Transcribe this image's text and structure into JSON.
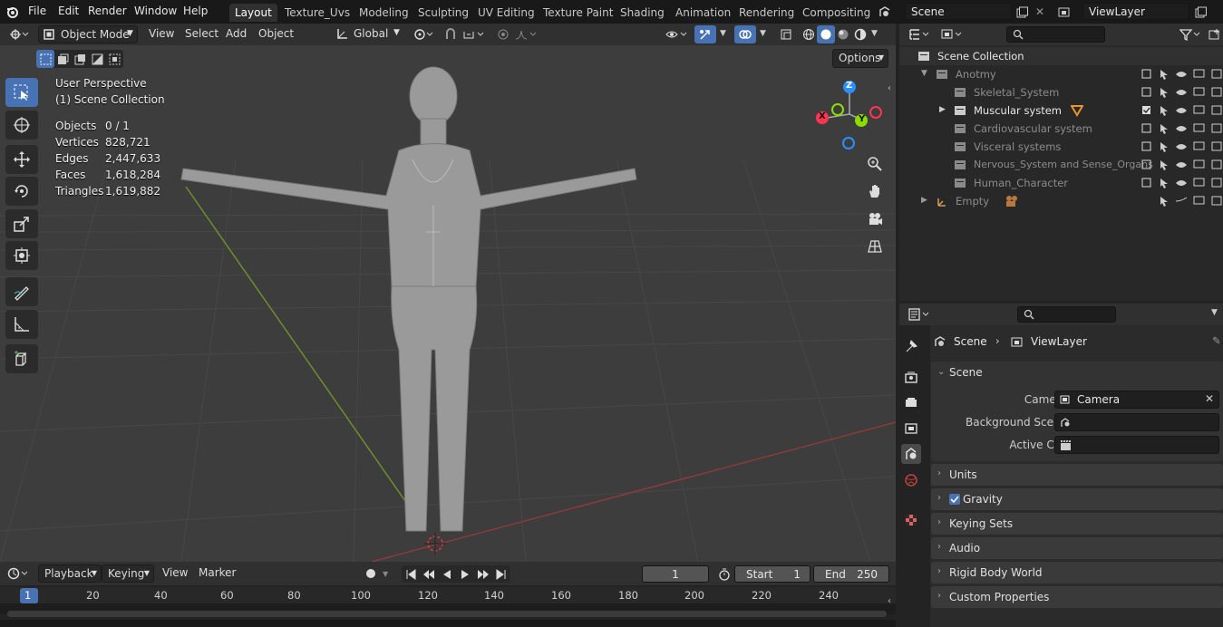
{
  "topbar": {
    "menus": [
      "File",
      "Edit",
      "Render",
      "Window",
      "Help"
    ],
    "workspaces": [
      "Layout",
      "Texture_Uvs",
      "Modeling",
      "Sculpting",
      "UV Editing",
      "Texture Paint",
      "Shading",
      "Animation",
      "Rendering",
      "Compositing"
    ],
    "active_workspace": "Layout",
    "scene_name": "Scene",
    "view_layer_name": "ViewLayer"
  },
  "viewport_header": {
    "mode": "Object Mode",
    "menus": [
      "View",
      "Select",
      "Add",
      "Object"
    ],
    "orientation": "Global",
    "options_label": "Options"
  },
  "overlay": {
    "view_name": "User Perspective",
    "collection": "(1) Scene Collection",
    "stats": [
      {
        "label": "Objects",
        "value": "0 / 1"
      },
      {
        "label": "Vertices",
        "value": "828,721"
      },
      {
        "label": "Edges",
        "value": "2,447,633"
      },
      {
        "label": "Faces",
        "value": "1,618,284"
      },
      {
        "label": "Triangles",
        "value": "1,619,882"
      }
    ]
  },
  "gizmo": {
    "z": "Z",
    "y": "Y",
    "x": "X"
  },
  "outliner": {
    "root": "Scene Collection",
    "items": [
      {
        "label": "Anotmy",
        "dim": true
      },
      {
        "label": "Skeletal_System",
        "dim": true
      },
      {
        "label": "Muscular system",
        "dim": false
      },
      {
        "label": "Cardiovascular system",
        "dim": true
      },
      {
        "label": "Visceral systems",
        "dim": true
      },
      {
        "label": "Nervous_System and Sense_Organs",
        "dim": true
      },
      {
        "label": "Human_Character",
        "dim": true
      },
      {
        "label": "Empty",
        "dim": true
      }
    ]
  },
  "properties": {
    "breadcrumb_scene": "Scene",
    "breadcrumb_viewlayer": "ViewLayer",
    "scene_panel": "Scene",
    "camera_label": "Camera",
    "camera_value": "Camera",
    "background_scene_label": "Background Scene",
    "active_clip_label": "Active Clip",
    "panels": [
      "Units",
      "Gravity",
      "Keying Sets",
      "Audio",
      "Rigid Body World",
      "Custom Properties"
    ]
  },
  "timeline": {
    "menus": [
      "Playback",
      "Keying",
      "View",
      "Marker"
    ],
    "current_frame": "1",
    "start_label": "Start",
    "start_value": "1",
    "end_label": "End",
    "end_value": "250",
    "ticks": [
      "1",
      "20",
      "40",
      "60",
      "80",
      "100",
      "120",
      "140",
      "160",
      "180",
      "200",
      "220",
      "240"
    ]
  },
  "colors": {
    "accent": "#4772b3",
    "x_axis": "#ff3352",
    "y_axis": "#8bdc00",
    "z_axis": "#2890ff",
    "header": "#303030",
    "viewport": "#3d3d3d"
  }
}
